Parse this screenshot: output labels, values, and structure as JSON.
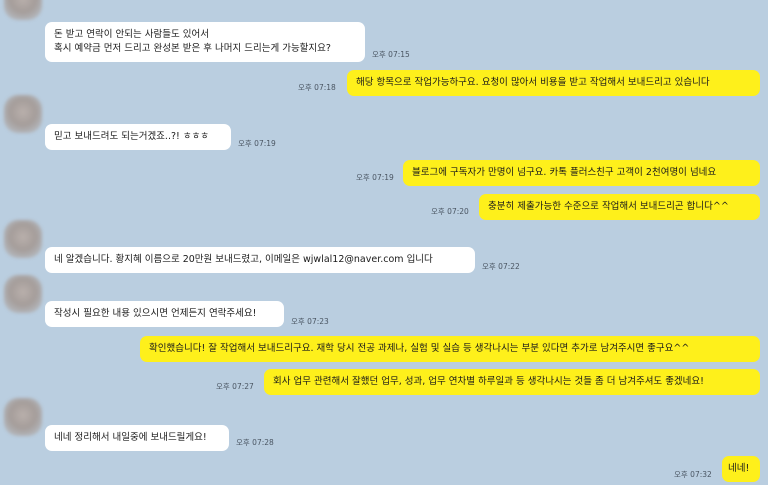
{
  "messages": [
    {
      "dir": "in",
      "lines": [
        "돈 받고 연락이 안되는 사람들도 있어서",
        "혹시 예약금 먼저 드리고 완성본 받은 후 나머지 드리는게 가능할지요?"
      ],
      "time": "오후 07:15"
    },
    {
      "dir": "out",
      "lines": [
        "해당 항목으로 작업가능하구요. 요청이 많아서 비용을 받고 작업해서 보내드리고 있습니다"
      ],
      "time": "오후 07:18"
    },
    {
      "dir": "in",
      "lines": [
        "믿고 보내드려도 되는거겠죠..?! ㅎㅎㅎ"
      ],
      "time": "오후 07:19"
    },
    {
      "dir": "out",
      "lines": [
        "블로그에 구독자가 만명이 넘구요. 카톡 플러스친구 고객이 2천여명이 넘네요"
      ],
      "time": "오후 07:19"
    },
    {
      "dir": "out",
      "lines": [
        "충분히 제출가능한 수준으로 작업해서 보내드리곤 합니다^^"
      ],
      "time": "오후 07:20"
    },
    {
      "dir": "in",
      "lines": [
        "네 알겠습니다. 황지혜 이름으로 20만원 보내드렸고, 이메일은 wjwlal12@naver.com 입니다"
      ],
      "time": "오후 07:22"
    },
    {
      "dir": "in",
      "lines": [
        "작성시 필요한 내용 있으시면 언제든지 연락주세요!"
      ],
      "time": "오후 07:23"
    },
    {
      "dir": "out",
      "lines": [
        "확인했습니다! 잘 작업해서 보내드리구요. 재학 당시 전공 과제나, 실험 및 실습 등 생각나시는 부분 있다면 추가로 남겨주시면 좋구요^^"
      ],
      "time": ""
    },
    {
      "dir": "out",
      "lines": [
        "회사 업무 관련해서 잘했던 업무, 성과, 업무 연차별 하루일과 등 생각나시는 것들 좀 더 남겨주셔도 좋겠네요!"
      ],
      "time": "오후 07:27"
    },
    {
      "dir": "in",
      "lines": [
        "네네 정리해서 내일중에 보내드릴게요!"
      ],
      "time": "오후 07:28"
    },
    {
      "dir": "out",
      "lines": [
        "네네!"
      ],
      "time": "오후 07:32"
    }
  ]
}
